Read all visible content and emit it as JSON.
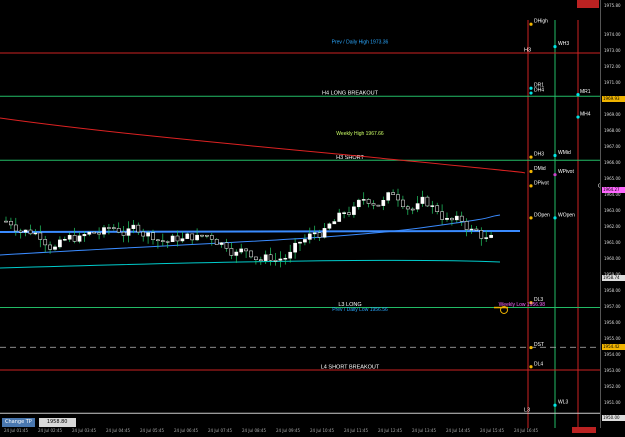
{
  "change_tp": {
    "label": "Change TP",
    "value": "1958.80"
  },
  "y_axis": {
    "ticks": [
      "1975.80",
      "1974.00",
      "1973.00",
      "1972.00",
      "1971.00",
      "1970.00",
      "1969.00",
      "1968.00",
      "1967.00",
      "1966.00",
      "1965.00",
      "1964.00",
      "1963.00",
      "1962.00",
      "1961.00",
      "1960.00",
      "1959.00",
      "1958.00",
      "1957.00",
      "1956.00",
      "1955.00",
      "1954.00",
      "1953.00",
      "1952.00",
      "1951.00",
      "1950.00"
    ],
    "highlights": [
      {
        "text": "1969.93",
        "color": "#f0b400"
      },
      {
        "text": "1964.27",
        "color": "#ff66ff"
      },
      {
        "text": "1958.74",
        "color": "#dddddd"
      },
      {
        "text": "1954.42",
        "color": "#f0b400"
      },
      {
        "text": "1950.00",
        "color": "#dddddd"
      }
    ]
  },
  "x_axis": {
    "ticks": [
      "24 Jul 01:45",
      "24 Jul 02:45",
      "24 Jul 03:45",
      "24 Jul 04:45",
      "24 Jul 05:45",
      "24 Jul 06:45",
      "24 Jul 07:45",
      "24 Jul 08:45",
      "24 Jul 09:45",
      "24 Jul 10:45",
      "24 Jul 11:45",
      "24 Jul 12:45",
      "24 Jul 13:45",
      "24 Jul 14:45",
      "24 Jul 15:45",
      "24 Jul 16:45"
    ]
  },
  "levels": [
    {
      "label": "DHigh",
      "price": 1974.6,
      "color": "#ffffff",
      "dot": "#f0b400",
      "full": false
    },
    {
      "label": "Prev / Daily High 1973.36",
      "price": 1973.3,
      "color": "#2aa8ff",
      "dot": null,
      "full": false,
      "center": true
    },
    {
      "label": "WH3",
      "price": 1973.2,
      "color": "#ffffff",
      "dot": "#00e5e5",
      "full": false
    },
    {
      "label": "H3",
      "price": 1972.8,
      "color": "#ffffff",
      "dot": null,
      "full": true,
      "line": "#cc2222"
    },
    {
      "label": "DR1",
      "price": 1970.6,
      "color": "#ffffff",
      "dot": "#00e5e5",
      "full": false
    },
    {
      "label": "DH4",
      "price": 1970.3,
      "color": "#ffffff",
      "dot": "#00e5e5",
      "full": false
    },
    {
      "label": "H4 LONG BREAKOUT",
      "price": 1970.1,
      "color": "#ffffff",
      "dot": null,
      "full": true,
      "line": "#22bb66",
      "center": true
    },
    {
      "label": "MR1",
      "price": 1970.2,
      "color": "#ffffff",
      "dot": "#00e5e5",
      "full": false
    },
    {
      "label": "MH4",
      "price": 1968.8,
      "color": "#ffffff",
      "dot": "#00e5e5",
      "full": false
    },
    {
      "label": "Weekly High 1967.66",
      "price": 1967.6,
      "color": "#ccff66",
      "dot": null,
      "full": false,
      "center": true
    },
    {
      "label": "DH3",
      "price": 1966.3,
      "color": "#ffffff",
      "dot": "#f0b400",
      "full": false
    },
    {
      "label": "WMid",
      "price": 1966.4,
      "color": "#ffffff",
      "dot": "#00e5e5",
      "full": false
    },
    {
      "label": "H3 SHORT",
      "price": 1966.1,
      "color": "#ffffff",
      "dot": null,
      "full": true,
      "line": "#22bb66",
      "center": true
    },
    {
      "label": "DMid",
      "price": 1965.4,
      "color": "#ffffff",
      "dot": "#f0b400",
      "full": false
    },
    {
      "label": "WPivot",
      "price": 1965.2,
      "color": "#ffffff",
      "dot": "#cc44cc",
      "full": false
    },
    {
      "label": "DPivot",
      "price": 1964.5,
      "color": "#ffffff",
      "dot": "#f0b400",
      "full": false
    },
    {
      "label": "G",
      "price": 1964.3,
      "color": "#ffffff",
      "dot": null,
      "full": false
    },
    {
      "label": "DOpen",
      "price": 1962.5,
      "color": "#ffffff",
      "dot": "#f0b400",
      "full": false
    },
    {
      "label": "WOpen",
      "price": 1962.5,
      "color": "#ffffff",
      "dot": "#00e5e5",
      "full": false
    },
    {
      "label": "DL3",
      "price": 1957.2,
      "color": "#ffffff",
      "dot": "#f0b400",
      "full": false
    },
    {
      "label": "L3 LONG",
      "price": 1956.9,
      "color": "#ffffff",
      "dot": null,
      "full": true,
      "line": "#22bb66",
      "center": true
    },
    {
      "label": "Weekly Low 1956.98",
      "price": 1956.9,
      "color": "#ff66ff",
      "dot": null,
      "full": false,
      "right": true
    },
    {
      "label": "Prev / Daily Low 1956.56",
      "price": 1956.6,
      "color": "#2aa8ff",
      "dot": null,
      "full": false,
      "center": true
    },
    {
      "label": "DST",
      "price": 1954.4,
      "color": "#ffffff",
      "dot": "#f0b400",
      "full": false
    },
    {
      "label": "DL4",
      "price": 1953.2,
      "color": "#ffffff",
      "dot": "#f0b400",
      "full": false
    },
    {
      "label": "L4 SHORT BREAKOUT",
      "price": 1953.0,
      "color": "#ffffff",
      "dot": null,
      "full": true,
      "line": "#cc2222",
      "center": true
    },
    {
      "label": "WL3",
      "price": 1950.8,
      "color": "#ffffff",
      "dot": "#00e5e5",
      "full": false
    },
    {
      "label": "L3",
      "price": 1950.3,
      "color": "#ffffff",
      "dot": null,
      "full": true,
      "line": "#cccccc"
    }
  ],
  "colors": {
    "bull": "#ffffff",
    "bear": "#ffffff",
    "wick": "#22cc66",
    "ma_blue": "#3a8bff",
    "ma_cyan": "#00cccc",
    "ma_red": "#dd2222"
  }
}
